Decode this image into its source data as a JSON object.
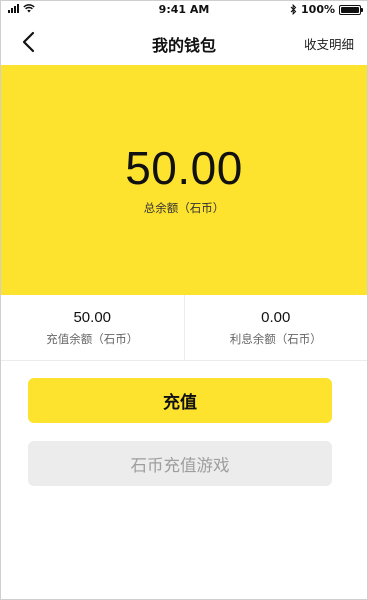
{
  "status_bar": {
    "time": "9:41 AM",
    "battery": "100%",
    "battery_level": 1.0,
    "icons": [
      "signal-icon",
      "wifi-icon",
      "bluetooth-icon",
      "battery-icon"
    ]
  },
  "nav": {
    "title": "我的钱包",
    "action_label": "收支明细",
    "back_icon": "chevron-left-icon"
  },
  "wallet": {
    "total_amount": "50.00",
    "total_label": "总余额（石币）",
    "recharge_balance": {
      "value": "50.00",
      "label": "充值余额（石币）"
    },
    "interest_balance": {
      "value": "0.00",
      "label": "利息余额（石币）"
    }
  },
  "buttons": {
    "recharge": "充值",
    "game_recharge": "石币充值游戏"
  },
  "colors": {
    "accent": "#fde22e",
    "disabled_bg": "#ececec",
    "disabled_text": "#9e9e9e"
  }
}
